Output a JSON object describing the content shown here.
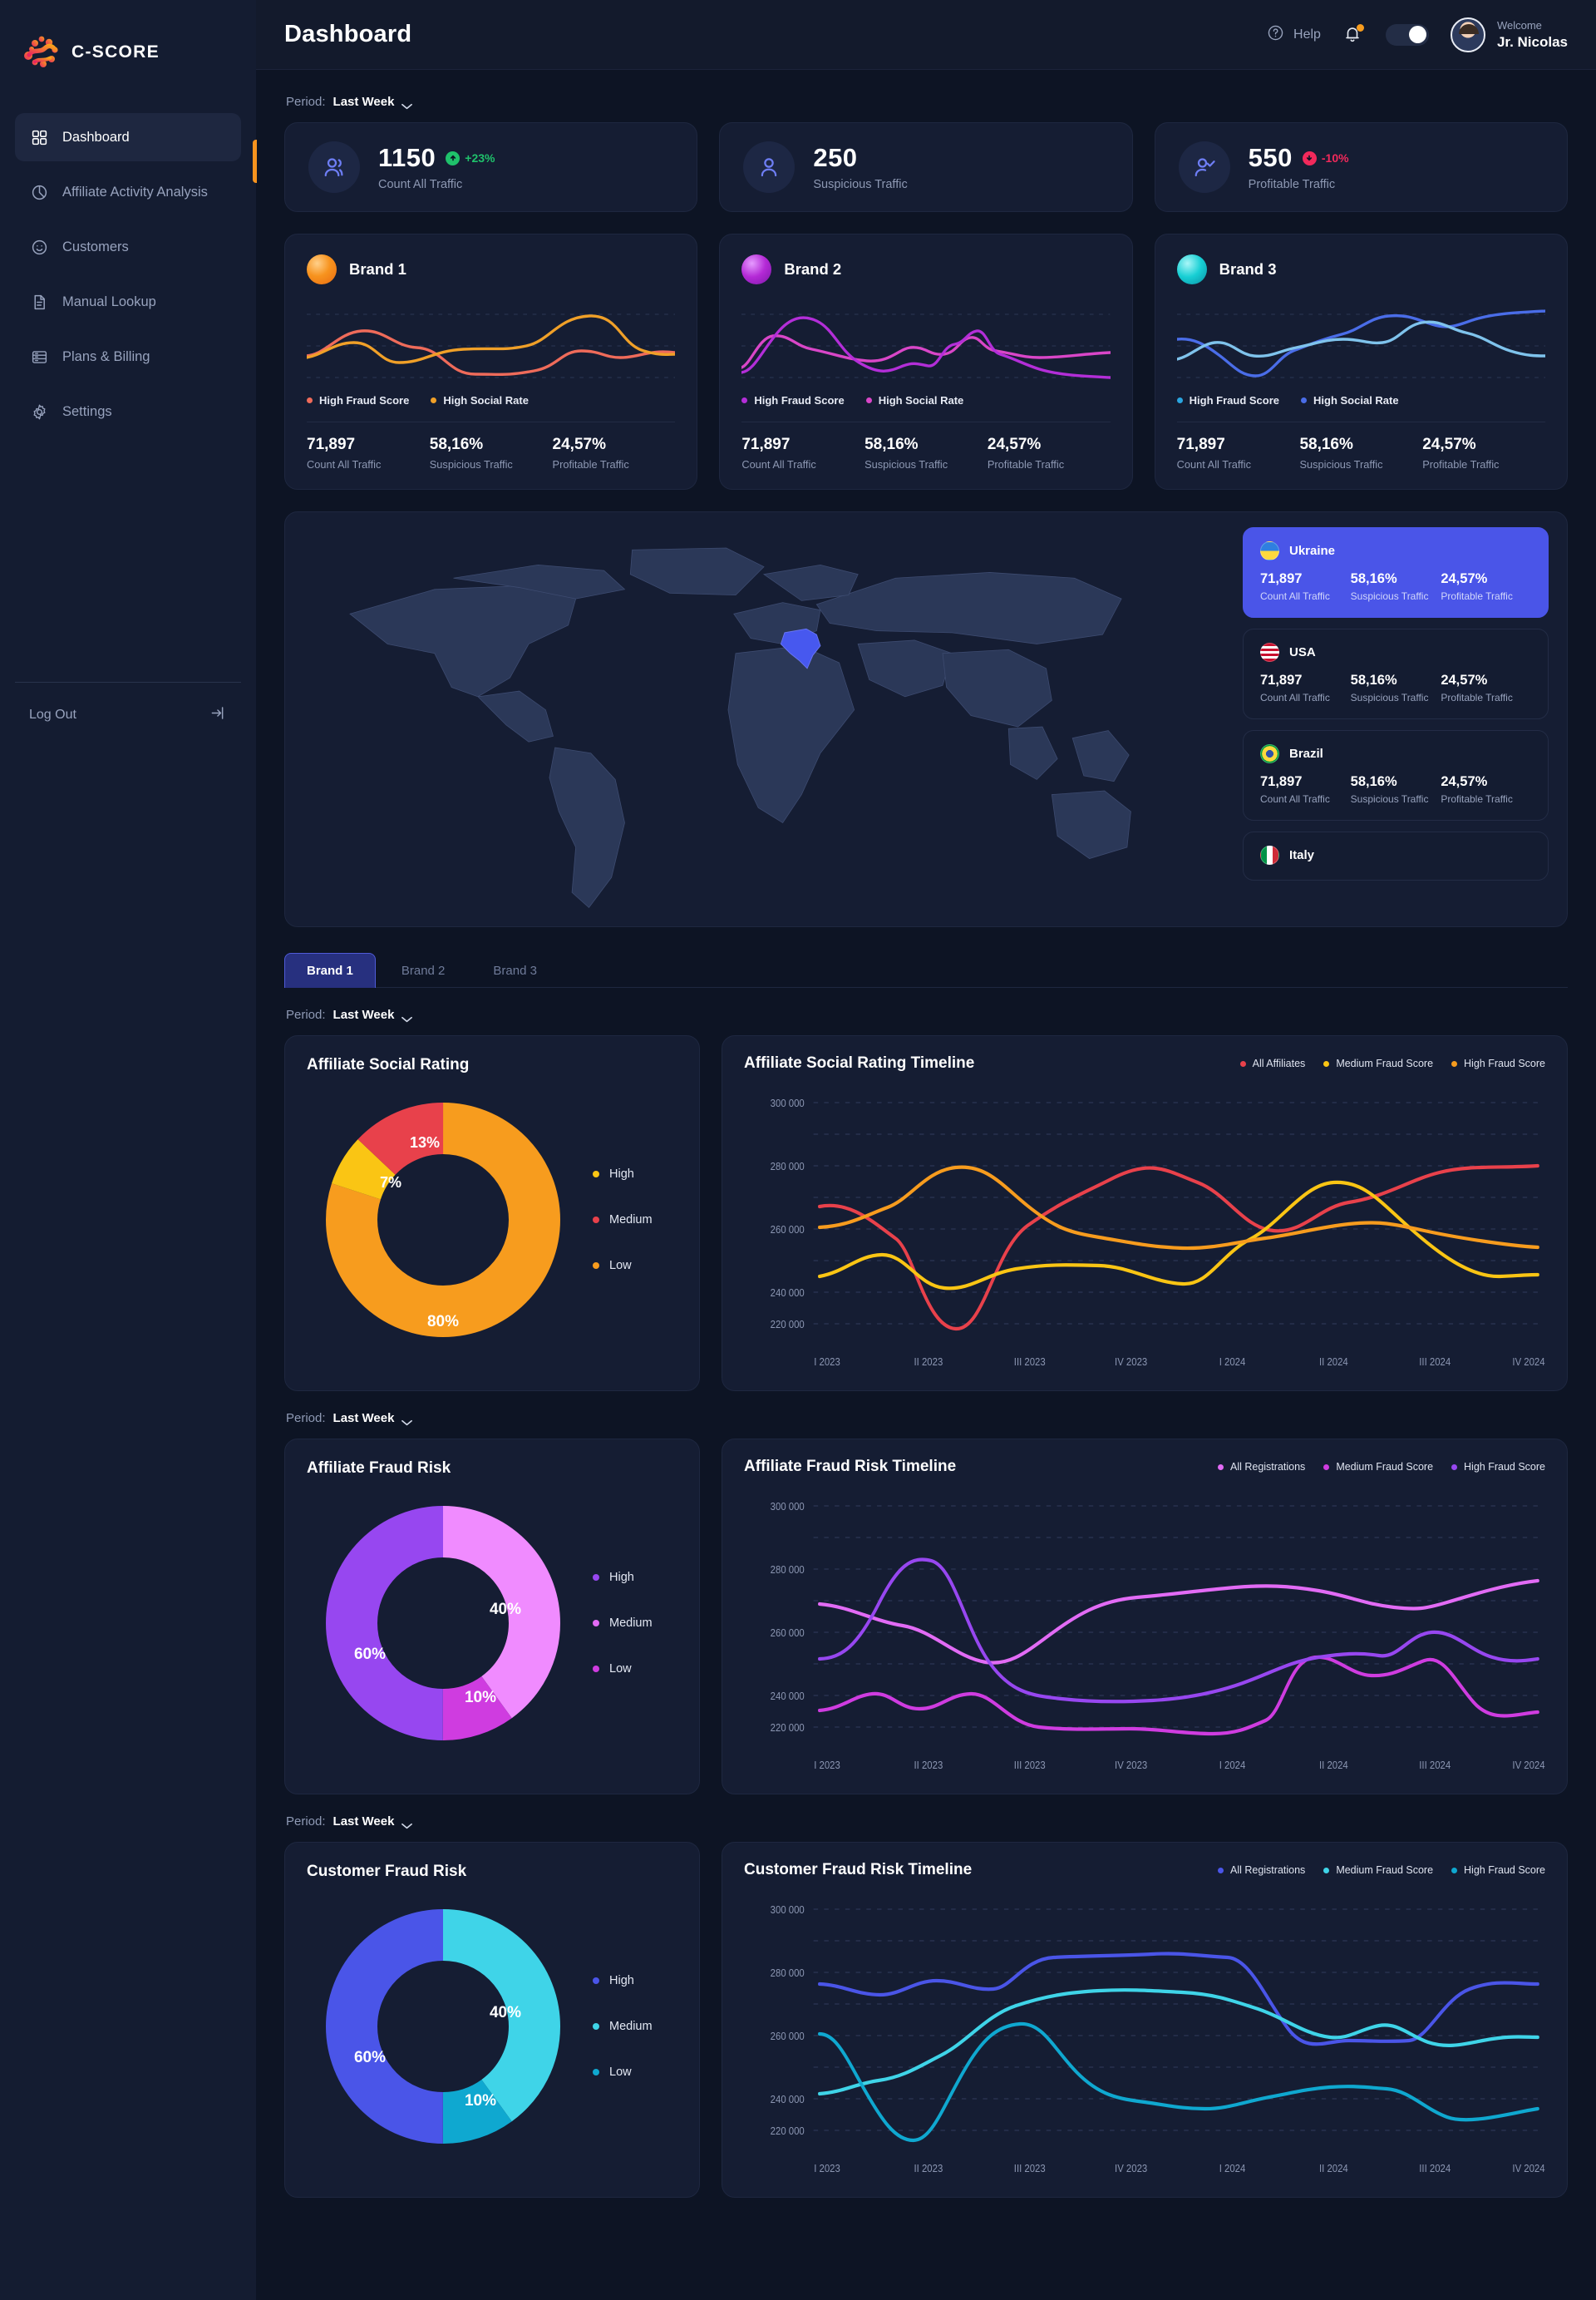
{
  "brand": {
    "logo_text": "C-SCORE"
  },
  "sidebar": {
    "items": [
      {
        "label": "Dashboard",
        "icon": "grid-icon"
      },
      {
        "label": "Affiliate Activity Analysis",
        "icon": "pie-chart-icon"
      },
      {
        "label": "Customers",
        "icon": "smiley-icon"
      },
      {
        "label": "Manual Lookup",
        "icon": "document-icon"
      },
      {
        "label": "Plans & Billing",
        "icon": "billing-icon"
      },
      {
        "label": "Settings",
        "icon": "gear-icon"
      }
    ],
    "logout_label": "Log Out"
  },
  "header": {
    "title": "Dashboard",
    "help_label": "Help",
    "welcome_label": "Welcome",
    "user_name": "Jr. Nicolas"
  },
  "period": {
    "label": "Period:",
    "value": "Last Week"
  },
  "kpis": [
    {
      "value": "1150",
      "label": "Count All Traffic",
      "delta": "+23%",
      "delta_dir": "up",
      "delta_color": "#1fc16b",
      "icon": "users-icon"
    },
    {
      "value": "250",
      "label": "Suspicious Traffic",
      "delta": "",
      "delta_dir": "",
      "delta_color": "",
      "icon": "user-icon"
    },
    {
      "value": "550",
      "label": "Profitable Traffic",
      "delta": "-10%",
      "delta_dir": "down",
      "delta_color": "#f2295b",
      "icon": "user-check-icon"
    }
  ],
  "brand_cards": [
    {
      "name": "Brand 1",
      "orb_color": "#f7931e",
      "legend": [
        {
          "label": "High Fraud Score",
          "color": "#ef6b5a"
        },
        {
          "label": "High Social Rate",
          "color": "#f0a028"
        }
      ],
      "stats": [
        {
          "value": "71,897",
          "label": "Count All Traffic"
        },
        {
          "value": "58,16%",
          "label": "Suspicious Traffic"
        },
        {
          "value": "24,57%",
          "label": "Profitable Traffic"
        }
      ]
    },
    {
      "name": "Brand 2",
      "orb_color": "#b429d6",
      "legend": [
        {
          "label": "High Fraud Score",
          "color": "#b32ed8"
        },
        {
          "label": "High Social Rate",
          "color": "#d946c8"
        }
      ],
      "stats": [
        {
          "value": "71,897",
          "label": "Count All Traffic"
        },
        {
          "value": "58,16%",
          "label": "Suspicious Traffic"
        },
        {
          "value": "24,57%",
          "label": "Profitable Traffic"
        }
      ]
    },
    {
      "name": "Brand 3",
      "orb_color": "#17cfd4",
      "legend": [
        {
          "label": "High Fraud Score",
          "color": "#2aa5e0"
        },
        {
          "label": "High Social Rate",
          "color": "#4a6de8"
        }
      ],
      "stats": [
        {
          "value": "71,897",
          "label": "Count All Traffic"
        },
        {
          "value": "58,16%",
          "label": "Suspicious Traffic"
        },
        {
          "value": "24,57%",
          "label": "Profitable Traffic"
        }
      ]
    }
  ],
  "countries": [
    {
      "name": "Ukraine",
      "flag": "ua",
      "active": true,
      "stats": [
        {
          "value": "71,897",
          "label": "Count All Traffic"
        },
        {
          "value": "58,16%",
          "label": "Suspicious Traffic"
        },
        {
          "value": "24,57%",
          "label": "Profitable Traffic"
        }
      ]
    },
    {
      "name": "USA",
      "flag": "us",
      "active": false,
      "stats": [
        {
          "value": "71,897",
          "label": "Count All Traffic"
        },
        {
          "value": "58,16%",
          "label": "Suspicious Traffic"
        },
        {
          "value": "24,57%",
          "label": "Profitable Traffic"
        }
      ]
    },
    {
      "name": "Brazil",
      "flag": "br",
      "active": false,
      "stats": [
        {
          "value": "71,897",
          "label": "Count All Traffic"
        },
        {
          "value": "58,16%",
          "label": "Suspicious Traffic"
        },
        {
          "value": "24,57%",
          "label": "Profitable Traffic"
        }
      ]
    },
    {
      "name": "Italy",
      "flag": "it",
      "active": false,
      "stats": []
    }
  ],
  "tabs": [
    {
      "label": "Brand 1",
      "active": true
    },
    {
      "label": "Brand 2",
      "active": false
    },
    {
      "label": "Brand 3",
      "active": false
    }
  ],
  "sections": [
    {
      "period": {
        "label": "Period:",
        "value": "Last Week"
      },
      "donut_title": "Affiliate Social Rating",
      "timeline_title": "Affiliate Social Rating Timeline"
    },
    {
      "period": {
        "label": "Period:",
        "value": "Last Week"
      },
      "donut_title": "Affiliate Fraud Risk",
      "timeline_title": "Affiliate Fraud Risk Timeline"
    },
    {
      "period": {
        "label": "Period:",
        "value": "Last Week"
      },
      "donut_title": "Customer Fraud Risk",
      "timeline_title": "Customer Fraud Risk Timeline"
    }
  ],
  "chart_data": [
    {
      "type": "pie",
      "title": "Affiliate Social Rating",
      "labels": [
        "Low",
        "Medium",
        "High"
      ],
      "values": [
        80,
        13,
        7
      ],
      "value_labels": [
        "80%",
        "13%",
        "7%"
      ],
      "colors": [
        "#f79c1e",
        "#e8414b",
        "#fac514"
      ],
      "legend": [
        {
          "label": "High",
          "color": "#fac514"
        },
        {
          "label": "Medium",
          "color": "#e8414b"
        },
        {
          "label": "Low",
          "color": "#f79c1e"
        }
      ],
      "legend_position": "right",
      "donut": true
    },
    {
      "type": "line",
      "title": "Affiliate Social Rating Timeline",
      "x": [
        "I 2023",
        "II 2023",
        "III 2023",
        "IV 2023",
        "I 2024",
        "II 2024",
        "III 2024",
        "IV 2024"
      ],
      "ylim": [
        220000,
        300000
      ],
      "yticks": [
        220000,
        240000,
        260000,
        280000,
        300000
      ],
      "ytick_labels": [
        "220 000",
        "240 000",
        "260 000",
        "280 000",
        "300 000"
      ],
      "xlabel": "",
      "ylabel": "",
      "grid": true,
      "legend_position": "top-right",
      "series": [
        {
          "name": "All Affiliates",
          "color": "#e8414b",
          "values": [
            267000,
            259000,
            228000,
            264000,
            279000,
            268000,
            261000,
            282000
          ]
        },
        {
          "name": "Medium Fraud Score",
          "color": "#fac514",
          "values": [
            245000,
            252000,
            243000,
            253000,
            248000,
            262000,
            278000,
            246000
          ]
        },
        {
          "name": "High Fraud Score",
          "color": "#f79c1e",
          "values": [
            262000,
            265000,
            281000,
            264000,
            256000,
            260000,
            265000,
            255000
          ]
        }
      ]
    },
    {
      "type": "pie",
      "title": "Affiliate Fraud Risk",
      "labels": [
        "High",
        "Medium",
        "Low"
      ],
      "values": [
        60,
        40,
        10
      ],
      "value_labels": [
        "60%",
        "40%",
        "10%"
      ],
      "colors": [
        "#9747f0",
        "#f08bff",
        "#cf3ce0"
      ],
      "legend": [
        {
          "label": "High",
          "color": "#9747f0"
        },
        {
          "label": "Medium",
          "color": "#e26bf5"
        },
        {
          "label": "Low",
          "color": "#cf3ce0"
        }
      ],
      "legend_position": "right",
      "donut": true
    },
    {
      "type": "line",
      "title": "Affiliate Fraud Risk Timeline",
      "x": [
        "I 2023",
        "II 2023",
        "III 2023",
        "IV 2023",
        "I 2024",
        "II 2024",
        "III 2024",
        "IV 2024"
      ],
      "ylim": [
        220000,
        300000
      ],
      "yticks": [
        220000,
        240000,
        260000,
        280000,
        300000
      ],
      "ytick_labels": [
        "220 000",
        "240 000",
        "260 000",
        "280 000",
        "300 000"
      ],
      "xlabel": "",
      "ylabel": "",
      "grid": true,
      "legend_position": "top-right",
      "series": [
        {
          "name": "All Registrations",
          "color": "#e26bf5",
          "values": [
            269000,
            263000,
            249000,
            268000,
            274000,
            272000,
            265000,
            275000
          ]
        },
        {
          "name": "Medium Fraud Score",
          "color": "#cf3ce0",
          "values": [
            235000,
            236000,
            237000,
            229000,
            228000,
            251000,
            256000,
            235000
          ]
        },
        {
          "name": "High Fraud Score",
          "color": "#9747f0",
          "values": [
            251000,
            284000,
            248000,
            239000,
            240000,
            251000,
            255000,
            251000
          ]
        }
      ]
    },
    {
      "type": "pie",
      "title": "Customer Fraud Risk",
      "labels": [
        "High",
        "Medium",
        "Low"
      ],
      "values": [
        60,
        40,
        10
      ],
      "value_labels": [
        "60%",
        "40%",
        "10%"
      ],
      "colors": [
        "#4a55e8",
        "#3fd4e8",
        "#0fa8d0"
      ],
      "legend": [
        {
          "label": "High",
          "color": "#4a55e8"
        },
        {
          "label": "Medium",
          "color": "#3fd4e8"
        },
        {
          "label": "Low",
          "color": "#0fa8d0"
        }
      ],
      "legend_position": "right",
      "donut": true
    },
    {
      "type": "line",
      "title": "Customer Fraud Risk Timeline",
      "x": [
        "I 2023",
        "II 2023",
        "III 2023",
        "IV 2023",
        "I 2024",
        "II 2024",
        "III 2024",
        "IV 2024"
      ],
      "ylim": [
        220000,
        300000
      ],
      "yticks": [
        220000,
        240000,
        260000,
        280000,
        300000
      ],
      "ytick_labels": [
        "220 000",
        "240 000",
        "260 000",
        "280 000",
        "300 000"
      ],
      "xlabel": "",
      "ylabel": "",
      "grid": true,
      "legend_position": "top-right",
      "series": [
        {
          "name": "All Registrations",
          "color": "#4a55e8",
          "values": [
            277000,
            277000,
            276000,
            284000,
            285000,
            259000,
            256000,
            277000
          ]
        },
        {
          "name": "Medium Fraud Score",
          "color": "#3fd4e8",
          "values": [
            243000,
            247000,
            259000,
            272000,
            273000,
            260000,
            258000,
            260000
          ]
        },
        {
          "name": "High Fraud Score",
          "color": "#0fa8d0",
          "values": [
            261000,
            228000,
            263000,
            246000,
            238000,
            242000,
            247000,
            236000
          ]
        }
      ]
    }
  ]
}
